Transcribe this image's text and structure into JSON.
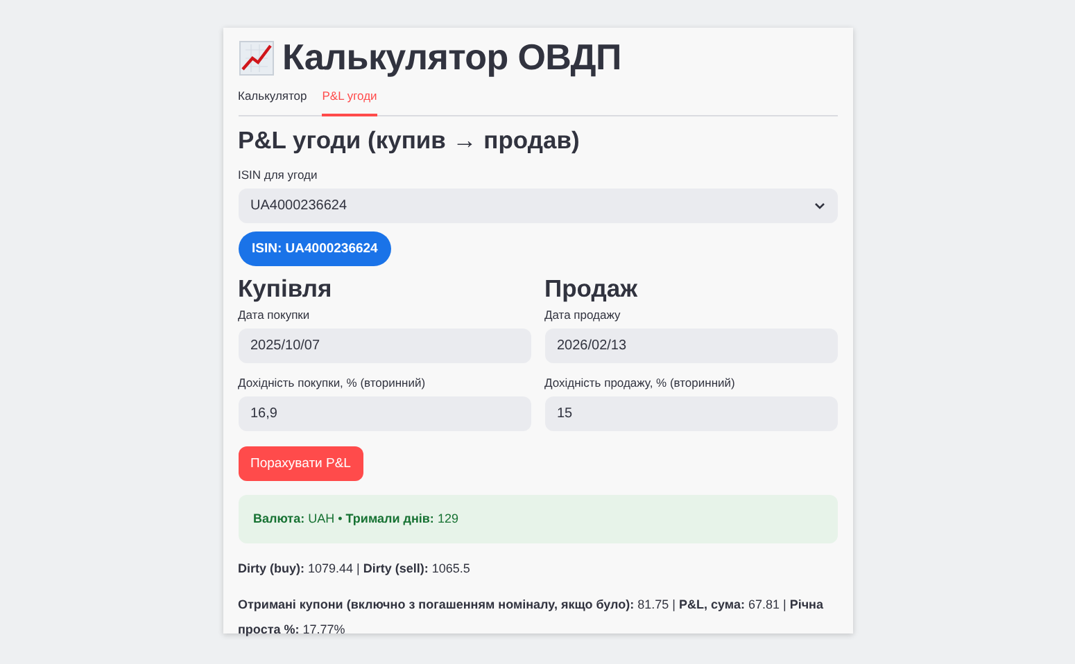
{
  "title": "Калькулятор ОВДП",
  "tabs": [
    {
      "label": "Калькулятор",
      "selected": false
    },
    {
      "label": "P&L угоди",
      "selected": true
    }
  ],
  "heading": "P&L угоди (купив → продав)",
  "isin_select": {
    "label": "ISIN для угоди",
    "value": "UA4000236624"
  },
  "isin_badge": "ISIN: UA4000236624",
  "columns": [
    {
      "heading": "Купівля",
      "fields": [
        {
          "label": "Дата покупки",
          "value": "2025/10/07"
        },
        {
          "label": "Дохідність покупки, % (вторинний)",
          "value": "16,9"
        }
      ]
    },
    {
      "heading": "Продаж",
      "fields": [
        {
          "label": "Дата продажу",
          "value": "2026/02/13"
        },
        {
          "label": "Дохідність продажу, % (вторинний)",
          "value": "15"
        }
      ]
    }
  ],
  "button": "Порахувати P&L",
  "info": "**Валюта:** UAH • **Тримали днів:** 129",
  "results": [
    "**Dirty (buy):** 1079.44 | **Dirty (sell):** 1065.5",
    "**Отримані купони (включно з погашенням номіналу, якщо було):** 81.75 | **P&L, сума:** 67.81 | **Річна проста %:** 17.77%"
  ]
}
